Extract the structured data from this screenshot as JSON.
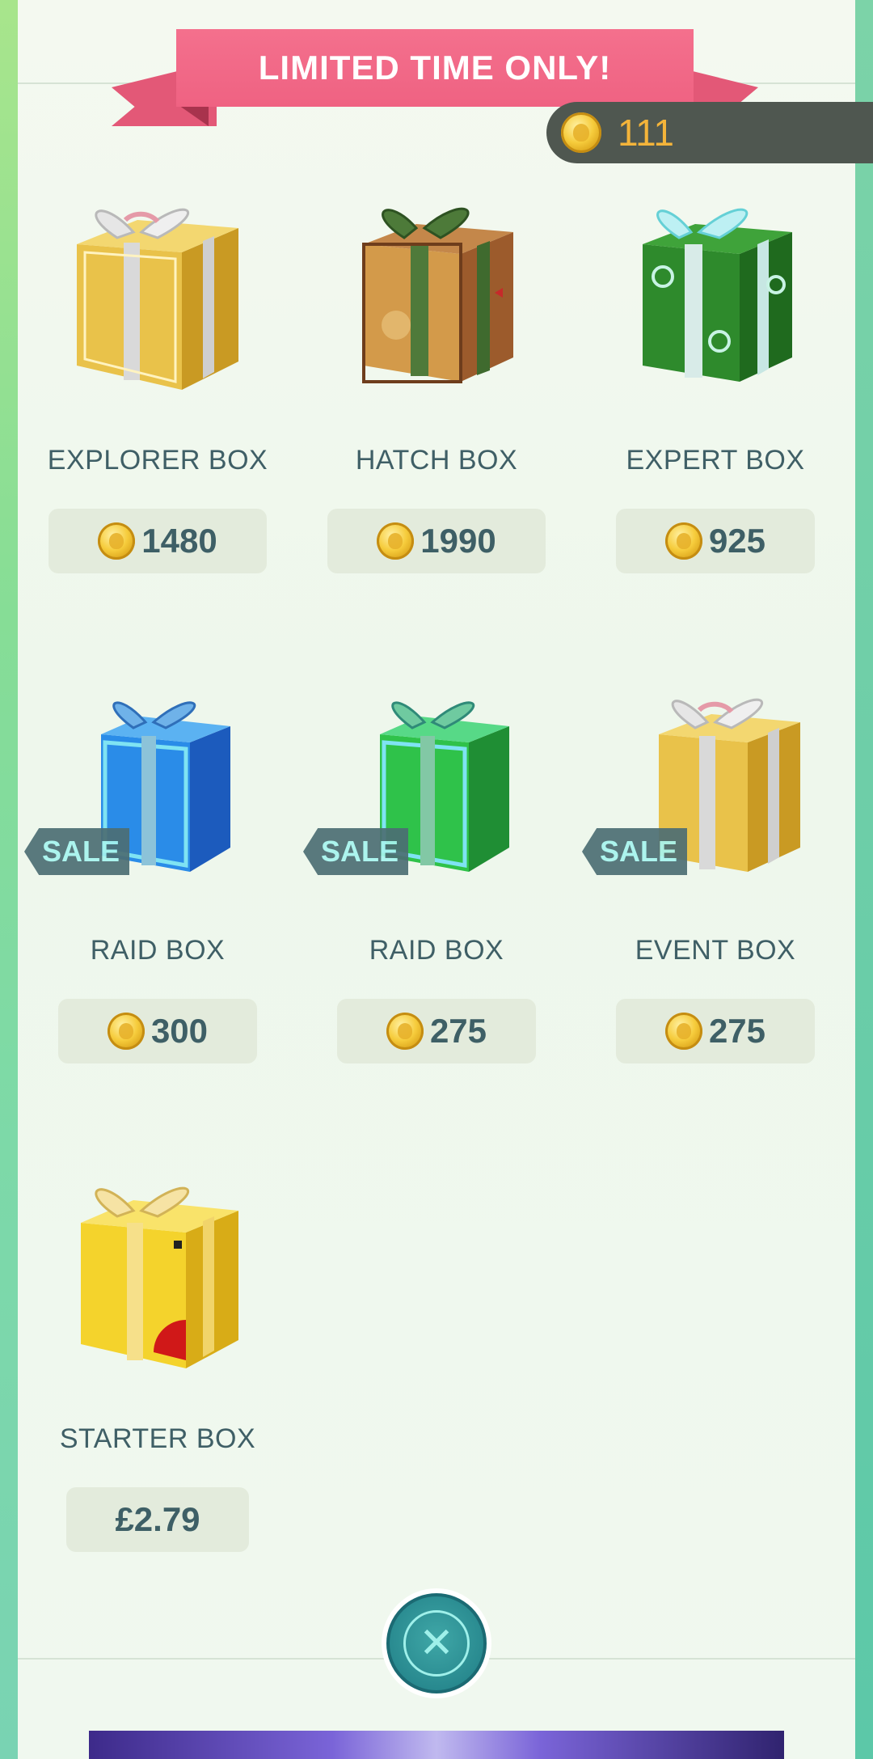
{
  "banner": {
    "text": "LIMITED TIME ONLY!"
  },
  "balance": {
    "amount": "111",
    "icon": "coin-icon"
  },
  "items": [
    {
      "name": "EXPLORER BOX",
      "price": "1480",
      "currency": "coin",
      "sale": false
    },
    {
      "name": "HATCH BOX",
      "price": "1990",
      "currency": "coin",
      "sale": false
    },
    {
      "name": "EXPERT BOX",
      "price": "925",
      "currency": "coin",
      "sale": false
    },
    {
      "name": "RAID BOX",
      "price": "300",
      "currency": "coin",
      "sale": true,
      "sale_label": "SALE"
    },
    {
      "name": "RAID BOX",
      "price": "275",
      "currency": "coin",
      "sale": true,
      "sale_label": "SALE"
    },
    {
      "name": "EVENT BOX",
      "price": "275",
      "currency": "coin",
      "sale": true,
      "sale_label": "SALE"
    },
    {
      "name": "STARTER BOX",
      "price": "£2.79",
      "currency": "money",
      "sale": false
    }
  ],
  "close": {
    "icon": "close-icon",
    "glyph": "✕"
  },
  "colors": {
    "banner": "#ef6282",
    "balance_text": "#f4b43a",
    "label": "#3f5f66",
    "sale_bg": "#4c6e73",
    "sale_text": "#a7f3ee"
  }
}
